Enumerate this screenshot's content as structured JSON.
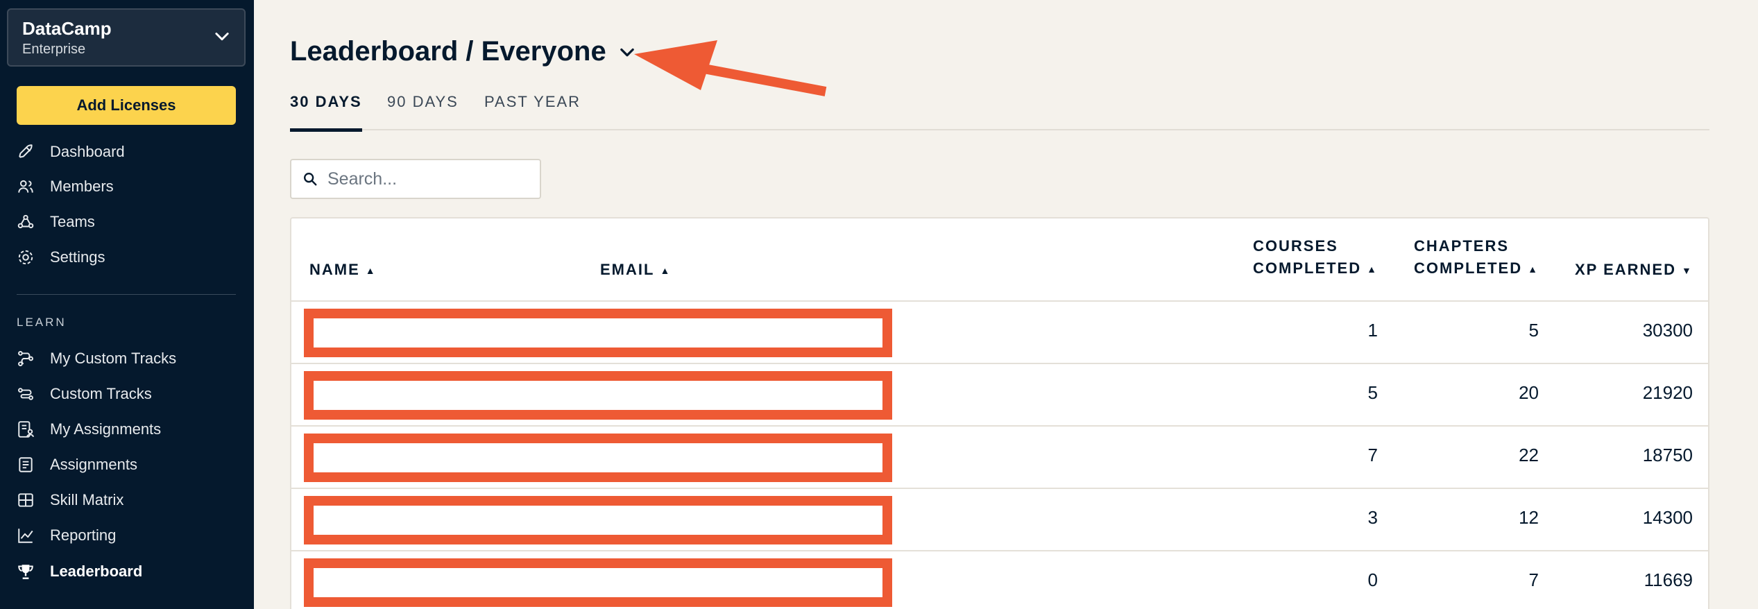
{
  "sidebar": {
    "org_name": "DataCamp",
    "org_sub": "Enterprise",
    "add_licenses": "Add Licenses",
    "items": [
      {
        "label": "Dashboard",
        "icon": "rocket-icon"
      },
      {
        "label": "Members",
        "icon": "members-icon"
      },
      {
        "label": "Teams",
        "icon": "teams-icon"
      },
      {
        "label": "Settings",
        "icon": "gear-icon"
      }
    ],
    "learn_label": "LEARN",
    "learn_items": [
      {
        "label": "My Custom Tracks",
        "icon": "track-icon"
      },
      {
        "label": "Custom Tracks",
        "icon": "track-icon"
      },
      {
        "label": "My Assignments",
        "icon": "assignment-user-icon"
      },
      {
        "label": "Assignments",
        "icon": "assignment-icon"
      },
      {
        "label": "Skill Matrix",
        "icon": "grid-icon"
      },
      {
        "label": "Reporting",
        "icon": "chart-line-icon"
      },
      {
        "label": "Leaderboard",
        "icon": "trophy-icon",
        "active": true
      }
    ]
  },
  "header": {
    "title": "Leaderboard / Everyone"
  },
  "tabs": [
    "30 DAYS",
    "90 DAYS",
    "PAST YEAR"
  ],
  "search": {
    "placeholder": "Search..."
  },
  "table": {
    "columns": {
      "name": "NAME",
      "email": "EMAIL",
      "courses_1": "COURSES",
      "courses_2": "COMPLETED",
      "chapters_1": "CHAPTERS",
      "chapters_2": "COMPLETED",
      "xp": "XP EARNED"
    },
    "rows": [
      {
        "courses": "1",
        "chapters": "5",
        "xp": "30300"
      },
      {
        "courses": "5",
        "chapters": "20",
        "xp": "21920"
      },
      {
        "courses": "7",
        "chapters": "22",
        "xp": "18750"
      },
      {
        "courses": "3",
        "chapters": "12",
        "xp": "14300"
      },
      {
        "courses": "0",
        "chapters": "7",
        "xp": "11669"
      }
    ]
  },
  "colors": {
    "sidebar_bg": "#05192d",
    "accent_yellow": "#fcd34d",
    "annotation_red": "#ee5a34"
  }
}
